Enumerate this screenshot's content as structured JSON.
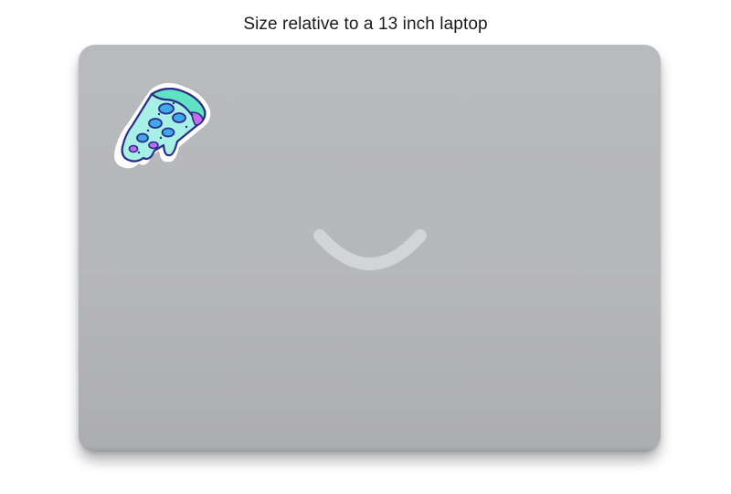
{
  "caption": {
    "text": "Size relative to a 13 inch laptop"
  },
  "laptop": {
    "body_color": "#b8b9bd",
    "logo_color": "#d3d4d7"
  },
  "sticker": {
    "icon": "pizza-slice-icon",
    "colors": {
      "crust": "#5fe3c4",
      "cheese": "#a6f0e6",
      "pepperoni": "#3ea8e8",
      "outline": "#2d2a8a",
      "accent": "#c46cf0"
    }
  }
}
